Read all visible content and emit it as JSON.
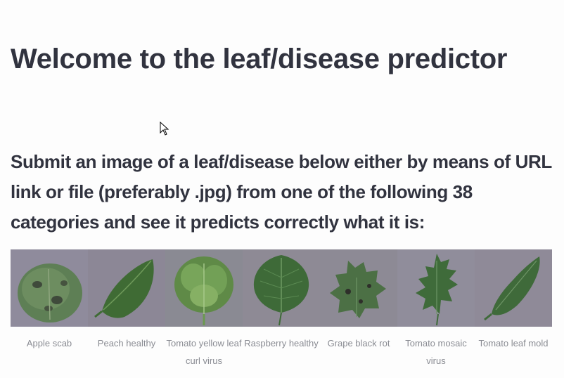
{
  "page": {
    "title": "Welcome to the leaf/disease predictor",
    "subtitle": "Submit an image of a leaf/disease below either by means of URL link or file (preferably .jpg) from one of the following 38 categories and see it predicts correctly what it is:"
  },
  "gallery": {
    "items": [
      {
        "caption": "Apple scab",
        "icon": "leaf-image-icon"
      },
      {
        "caption": "Peach healthy",
        "icon": "leaf-image-icon"
      },
      {
        "caption": "Tomato yellow leaf curl virus",
        "icon": "leaf-image-icon"
      },
      {
        "caption": "Raspberry healthy",
        "icon": "leaf-image-icon"
      },
      {
        "caption": "Grape black rot",
        "icon": "leaf-image-icon"
      },
      {
        "caption": "Tomato mosaic virus",
        "icon": "leaf-image-icon"
      },
      {
        "caption": "Tomato leaf mold",
        "icon": "leaf-image-icon"
      }
    ]
  },
  "colors": {
    "text": "#31333f",
    "caption": "#8a8c93",
    "background": "#fdfdfd"
  }
}
